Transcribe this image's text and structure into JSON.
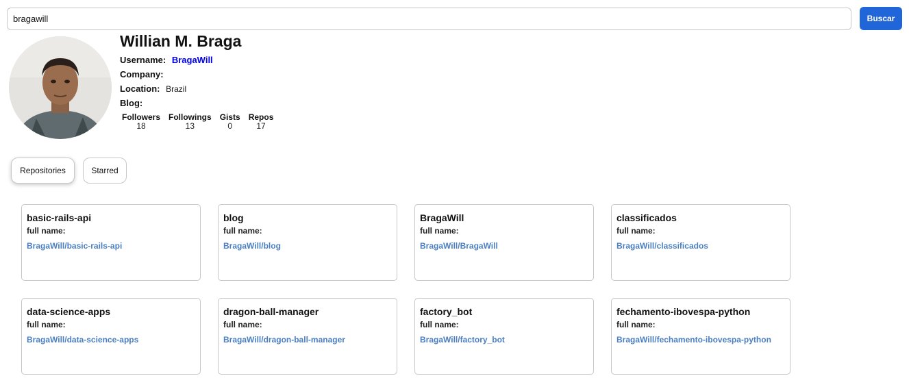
{
  "search": {
    "value": "bragawill",
    "button_label": "Buscar"
  },
  "profile": {
    "name": "Willian M. Braga",
    "fields": [
      {
        "key": "Username:",
        "value": "BragaWill",
        "link": true
      },
      {
        "key": "Company:",
        "value": "",
        "link": false
      },
      {
        "key": "Location:",
        "value": "Brazil",
        "link": false
      },
      {
        "key": "Blog:",
        "value": "",
        "link": false
      }
    ],
    "stats": [
      {
        "label": "Followers",
        "value": "18"
      },
      {
        "label": "Followings",
        "value": "13"
      },
      {
        "label": "Gists",
        "value": "0"
      },
      {
        "label": "Repos",
        "value": "17"
      }
    ]
  },
  "tabs": [
    {
      "label": "Repositories",
      "active": true
    },
    {
      "label": "Starred",
      "active": false
    }
  ],
  "repos": [
    {
      "name": "basic-rails-api",
      "full_name_label": "full name:",
      "full_name": "BragaWill/basic-rails-api"
    },
    {
      "name": "blog",
      "full_name_label": "full name:",
      "full_name": "BragaWill/blog"
    },
    {
      "name": "BragaWill",
      "full_name_label": "full name:",
      "full_name": "BragaWill/BragaWill"
    },
    {
      "name": "classificados",
      "full_name_label": "full name:",
      "full_name": "BragaWill/classificados"
    },
    {
      "name": "data-science-apps",
      "full_name_label": "full name:",
      "full_name": "BragaWill/data-science-apps"
    },
    {
      "name": "dragon-ball-manager",
      "full_name_label": "full name:",
      "full_name": "BragaWill/dragon-ball-manager"
    },
    {
      "name": "factory_bot",
      "full_name_label": "full name:",
      "full_name": "BragaWill/factory_bot"
    },
    {
      "name": "fechamento-ibovespa-python",
      "full_name_label": "full name:",
      "full_name": "BragaWill/fechamento-ibovespa-python"
    }
  ],
  "colors": {
    "accent": "#2166d9",
    "username_link": "#0000ee",
    "repo_link": "#4a7fc1"
  }
}
